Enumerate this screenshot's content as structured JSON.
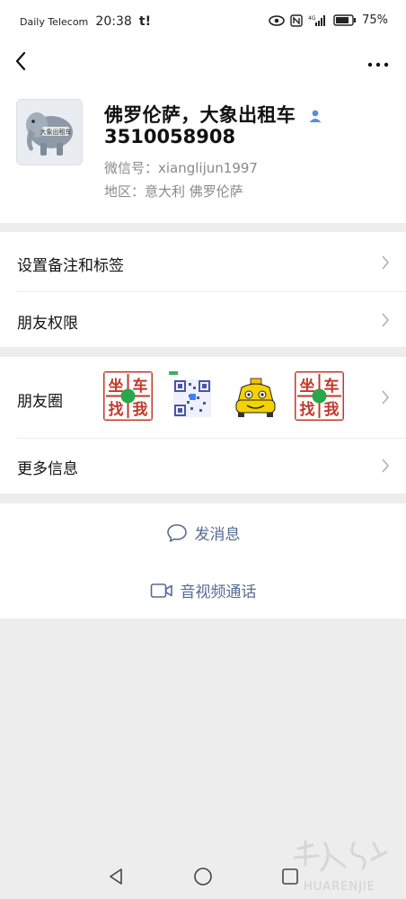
{
  "status_bar": {
    "carrier": "Daily Telecom",
    "time": "20:38",
    "extra": "t!",
    "battery_text": "75%"
  },
  "profile": {
    "name": "佛罗伦萨，大象出租车",
    "number": "3510058908",
    "wechat_id": "微信号：xianglijun1997",
    "region": "地区：意大利  佛罗伦萨",
    "avatar_text": "大象出租车"
  },
  "rows": {
    "remark_tags": "设置备注和标签",
    "friend_permissions": "朋友权限",
    "moments": "朋友圈",
    "more_info": "更多信息"
  },
  "moments_thumbs": [
    {
      "kind": "sign",
      "chars": [
        "坐",
        "车",
        "找",
        "我"
      ]
    },
    {
      "kind": "qr"
    },
    {
      "kind": "taxi"
    },
    {
      "kind": "sign",
      "chars": [
        "坐",
        "车",
        "找",
        "我"
      ]
    }
  ],
  "actions": {
    "send_message": "发消息",
    "video_call": "音视频通话"
  },
  "watermark": {
    "text": "HUARENJIE"
  },
  "colors": {
    "link": "#576b95",
    "background": "#ededed",
    "sign_red": "#c0392b",
    "sign_green": "#27a84a"
  }
}
